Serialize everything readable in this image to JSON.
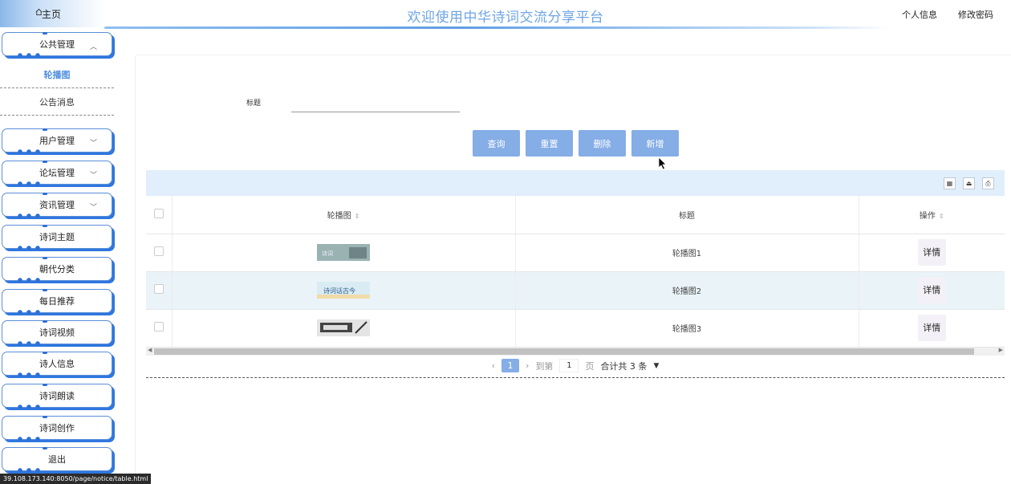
{
  "header": {
    "home_label": "主页",
    "title": "欢迎使用中华诗词交流分享平台",
    "profile_link": "个人信息",
    "password_link": "修改密码"
  },
  "sidebar": {
    "groups": [
      {
        "label": "公共管理",
        "expanded": true
      },
      {
        "label": "用户管理",
        "expanded": false
      },
      {
        "label": "论坛管理",
        "expanded": false
      },
      {
        "label": "资讯管理",
        "expanded": false
      }
    ],
    "subitems": [
      {
        "label": "轮播图",
        "active": true
      },
      {
        "label": "公告消息",
        "active": false
      }
    ],
    "items": [
      "诗词主题",
      "朝代分类",
      "每日推荐",
      "诗词视频",
      "诗人信息",
      "诗词朗读",
      "诗词创作",
      "退出"
    ]
  },
  "search": {
    "label": "标题",
    "value": "",
    "placeholder": ""
  },
  "buttons": {
    "query": "查询",
    "reset": "重置",
    "delete": "删除",
    "add": "新增"
  },
  "table": {
    "columns": [
      "轮播图",
      "标题",
      "操作"
    ],
    "rows": [
      {
        "title": "轮播图1",
        "action": "详情",
        "image_text": "诗词"
      },
      {
        "title": "轮播图2",
        "action": "详情",
        "image_text": "诗词话古今"
      },
      {
        "title": "轮播图3",
        "action": "详情",
        "image_text": ""
      }
    ]
  },
  "pager": {
    "current_page": "1",
    "goto_label": "到第",
    "page_input": "1",
    "page_unit": "页",
    "total": "合计共 3 条"
  },
  "statusbar": {
    "url": "39.108.173.140:8050/page/notice/table.html"
  },
  "colors": {
    "accent": "#85ade6",
    "title": "#6ea5e4",
    "menu_border": "#2f76df"
  }
}
